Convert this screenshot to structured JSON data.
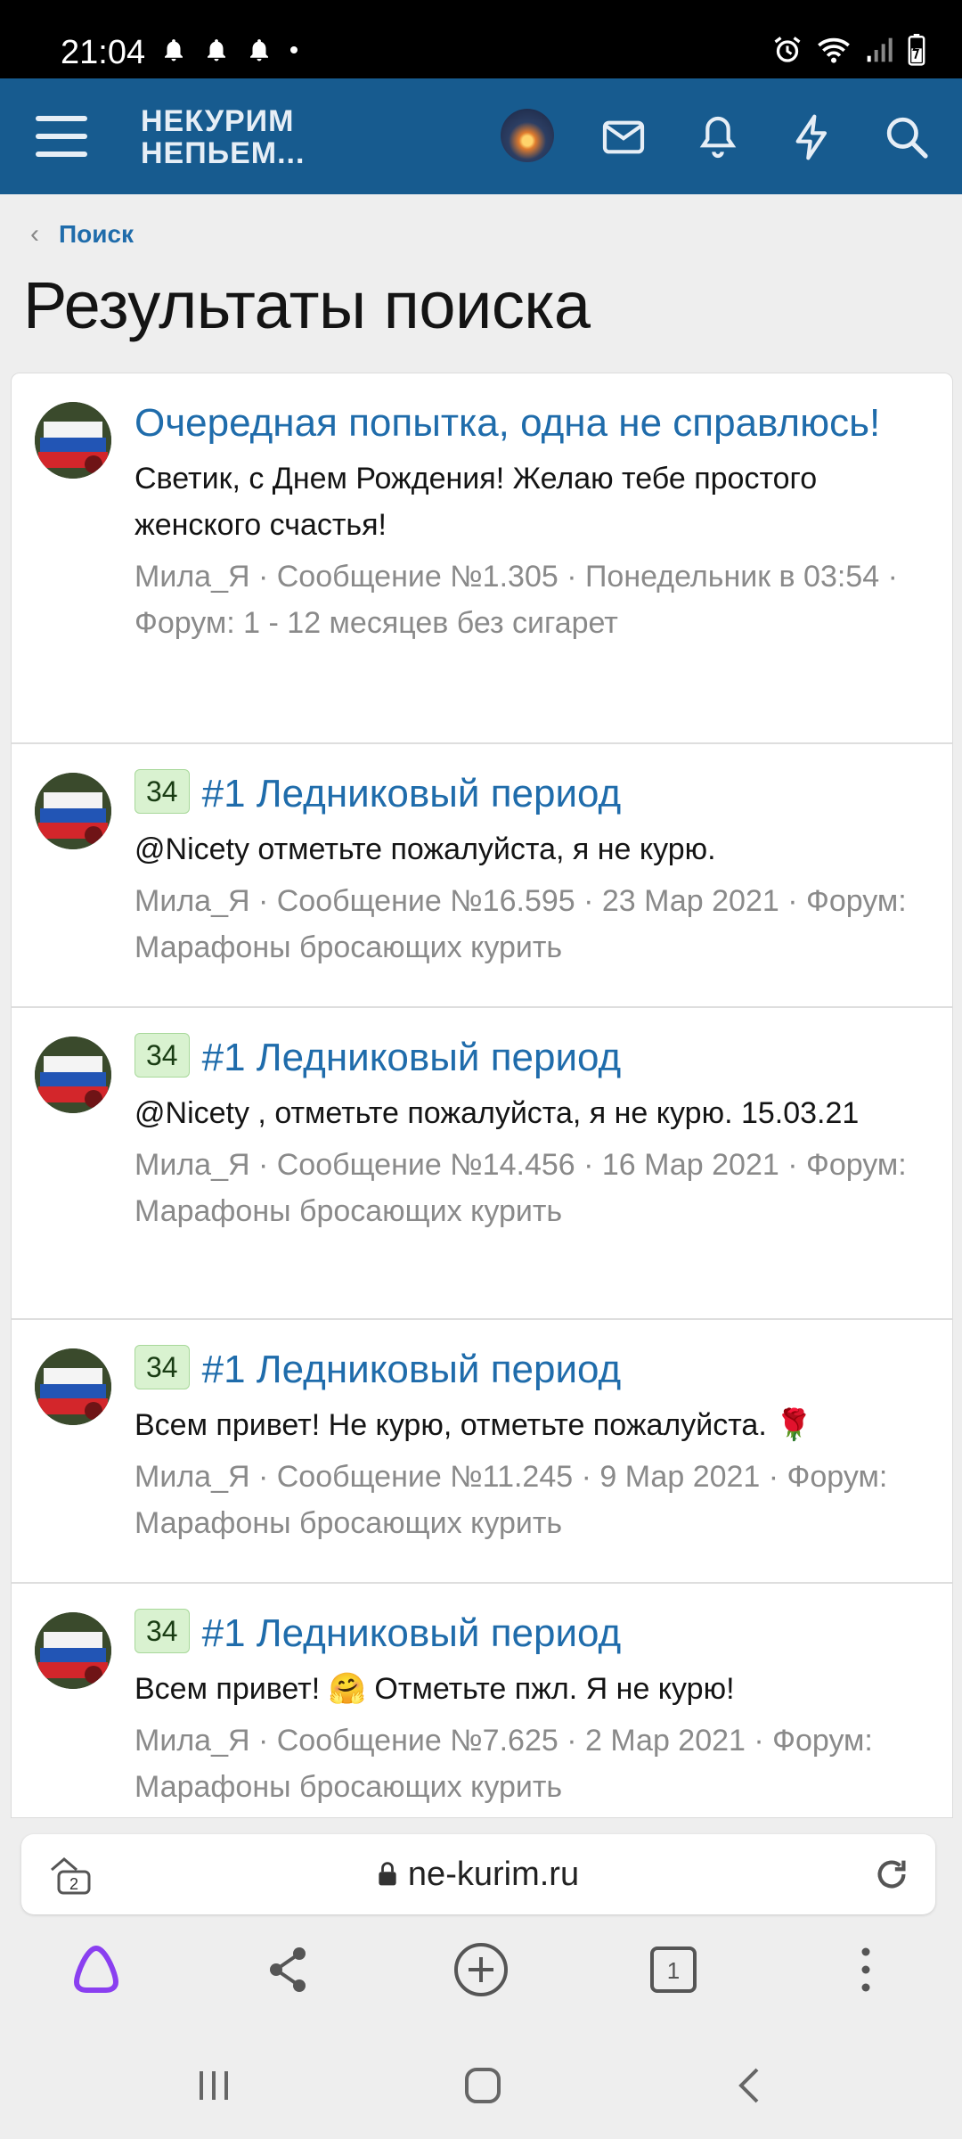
{
  "status": {
    "time": "21:04"
  },
  "app": {
    "logo_line1": "НЕКУРИМ",
    "logo_line2": "НЕПЬЕМ..."
  },
  "breadcrumb": {
    "label": "Поиск"
  },
  "page_title": "Результаты поиска",
  "results": [
    {
      "badge": "",
      "title": "Очередная попытка, одна не справлюсь!",
      "snippet": "Светик, с Днем Рождения! Желаю тебе простого женского счастья!",
      "meta": "Мила_Я · Сообщение №1.305 · Понедельник в 03:54 · Форум: 1 - 12 месяцев без сигарет"
    },
    {
      "badge": "34",
      "title": "#1 Ледниковый период",
      "snippet": "@Nicety отметьте пожалуйста, я не курю.",
      "meta": "Мила_Я · Сообщение №16.595 · 23 Мар 2021 · Форум: Марафоны бросающих курить"
    },
    {
      "badge": "34",
      "title": "#1 Ледниковый период",
      "snippet": "@Nicety , отметьте пожалуйста, я не курю. 15.03.21",
      "meta": "Мила_Я · Сообщение №14.456 · 16 Мар 2021 · Форум: Марафоны бросающих курить"
    },
    {
      "badge": "34",
      "title": "#1 Ледниковый период",
      "snippet": "Всем привет! Не курю, отметьте пожалуйста. 🌹",
      "meta": "Мила_Я · Сообщение №11.245 · 9 Мар 2021 · Форум: Марафоны бросающих курить"
    },
    {
      "badge": "34",
      "title": "#1 Ледниковый период",
      "snippet": "Всем привет! 🤗 Отметьте пжл. Я не курю!",
      "meta": "Мила_Я · Сообщение №7.625 · 2 Мар 2021 · Форум: Марафоны бросающих курить"
    }
  ],
  "browser": {
    "domain": "ne-kurim.ru",
    "tabs_count": "2",
    "open_tabs": "1"
  },
  "colors": {
    "appbar": "#175b8f",
    "link": "#1f6cab",
    "badge_bg": "#d9f2d0",
    "alice": "#8a3ff0"
  }
}
